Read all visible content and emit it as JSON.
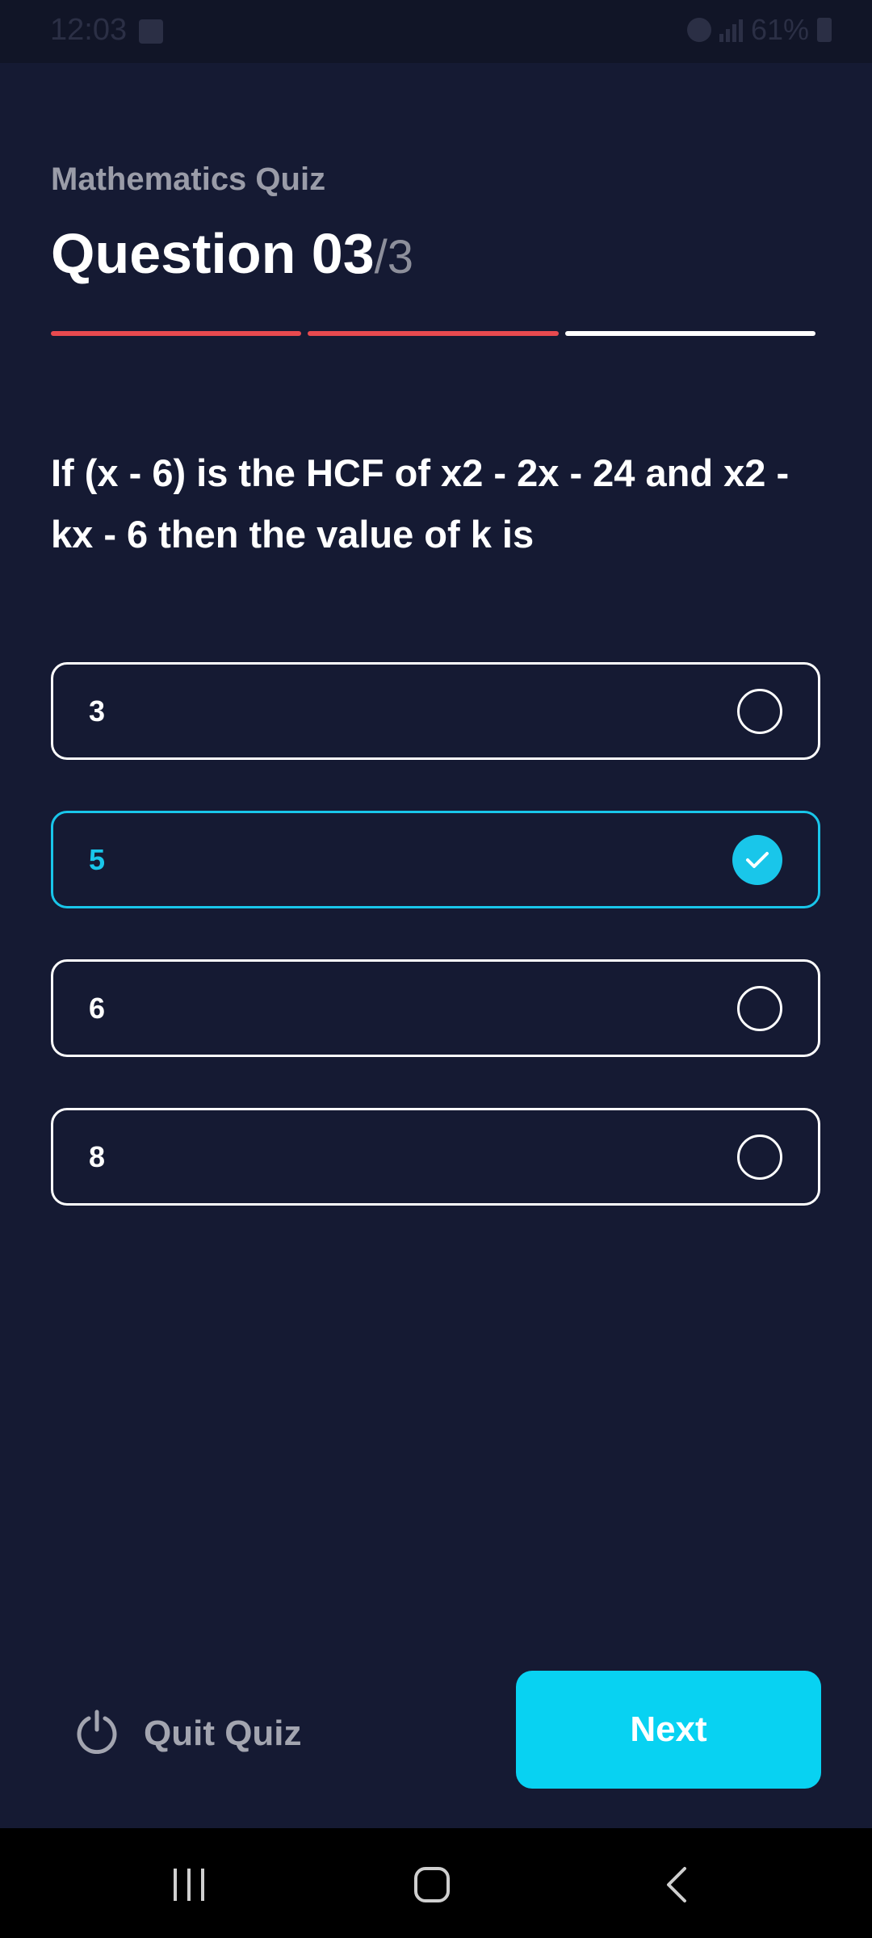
{
  "status_bar": {
    "time": "12:03",
    "battery": "61%"
  },
  "header": {
    "subtitle": "Mathematics Quiz",
    "question_label": "Question 03",
    "question_total": "/3"
  },
  "progress": {
    "total_steps": 3,
    "current_step": 3,
    "done_color": "#e84a4f",
    "current_color": "#ffffff"
  },
  "question": {
    "text": "If (x - 6) is the HCF of x2 - 2x - 24 and x2 - kx - 6 then the value of k is"
  },
  "options": [
    {
      "label": "3",
      "selected": false
    },
    {
      "label": "5",
      "selected": true
    },
    {
      "label": "6",
      "selected": false
    },
    {
      "label": "8",
      "selected": false
    }
  ],
  "footer": {
    "quit_label": "Quit Quiz",
    "next_label": "Next"
  },
  "colors": {
    "background": "#151a33",
    "accent": "#08d2f2",
    "selected": "#19c6ea"
  },
  "icons": {
    "quit": "power-icon",
    "selected": "check-icon",
    "nav": [
      "recent-apps-icon",
      "home-icon",
      "back-icon"
    ]
  }
}
